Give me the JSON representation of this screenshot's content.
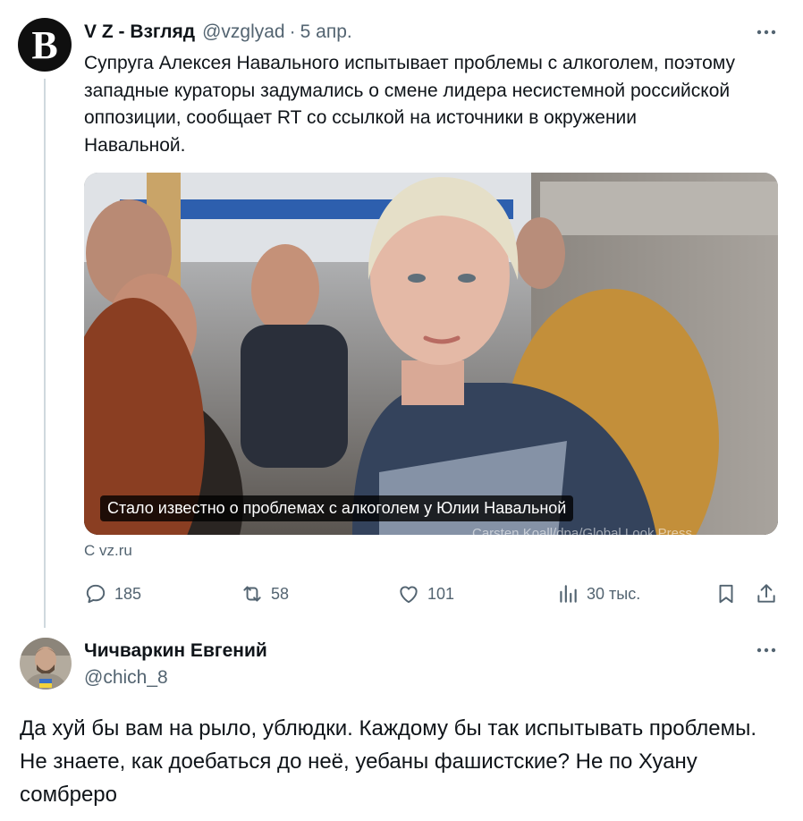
{
  "tweet": {
    "avatar_letter": "B",
    "author_name": "V Z - Взгляд",
    "author_handle": "@vzglyad",
    "separator": "·",
    "date": "5 апр.",
    "text": "Супруга Алексея Навального испытывает проблемы с алкоголем, поэтому\nзападные кураторы задумались о смене лидера несистемной российской\nоппозиции, сообщает RT со ссылкой на источники в окружении\nНавальной.",
    "card": {
      "caption": "Стало известно о проблемах с алкоголем у Юлии Навальной",
      "photo_credit": "Carsten Koall/dpa/Global Look Press"
    },
    "source": "С vz.ru",
    "actions": {
      "replies": "185",
      "reposts": "58",
      "likes": "101",
      "views": "30 тыс."
    }
  },
  "reply": {
    "author_name": "Чичваркин Евгений",
    "author_handle": "@chich_8",
    "text": "Да хуй бы вам на рыло, ублюдки. Каждому бы так испытывать проблемы. Не знаете, как доебаться до неё, уебаны фашистские? Не по Хуану сомбреро"
  },
  "icons": {
    "more": "more-horizontal-icon",
    "reply": "reply-bubble-icon",
    "repost": "repost-arrows-icon",
    "like": "heart-icon",
    "views": "views-bars-icon",
    "bookmark": "bookmark-icon",
    "share": "share-upload-icon"
  },
  "colors": {
    "text": "#0f1419",
    "secondary": "#536471",
    "thread_line": "#cfd9de"
  }
}
